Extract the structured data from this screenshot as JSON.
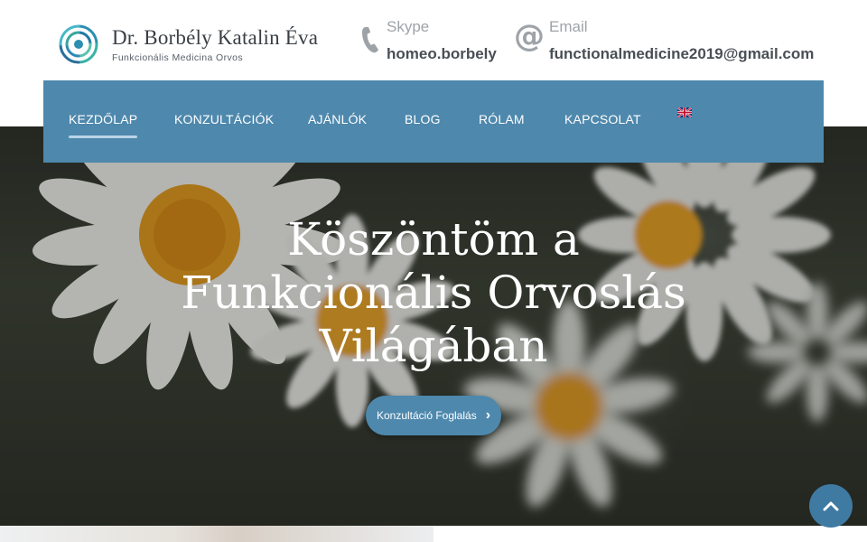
{
  "header": {
    "logo": {
      "name": "Dr. Borbély Katalin Éva",
      "subtitle": "Funkcionális Medicina Orvos",
      "icon": "logo-mark-icon"
    },
    "skype": {
      "label": "Skype",
      "value": "homeo.borbely",
      "icon": "phone-icon"
    },
    "email": {
      "label": "Email",
      "value": "functionalmedicine2019@gmail.com",
      "icon": "at-sign-icon"
    }
  },
  "nav": {
    "items": [
      {
        "label": "KEZDŐLAP",
        "active": true
      },
      {
        "label": "KONZULTÁCIÓK"
      },
      {
        "label": "AJÁNLÓK"
      },
      {
        "label": "BLOG"
      },
      {
        "label": "RÓLAM"
      },
      {
        "label": "KAPCSOLAT"
      }
    ],
    "language_icon": "uk-flag-icon",
    "color": "#4e88ad"
  },
  "hero": {
    "title_lines": [
      "Köszöntöm a",
      "Funkcionális Orvoslás",
      "Világában"
    ],
    "button_label": "Konzultáció Foglalás"
  },
  "colors": {
    "accent": "#4e88ad",
    "scroll_button": "#3f7aa3"
  }
}
